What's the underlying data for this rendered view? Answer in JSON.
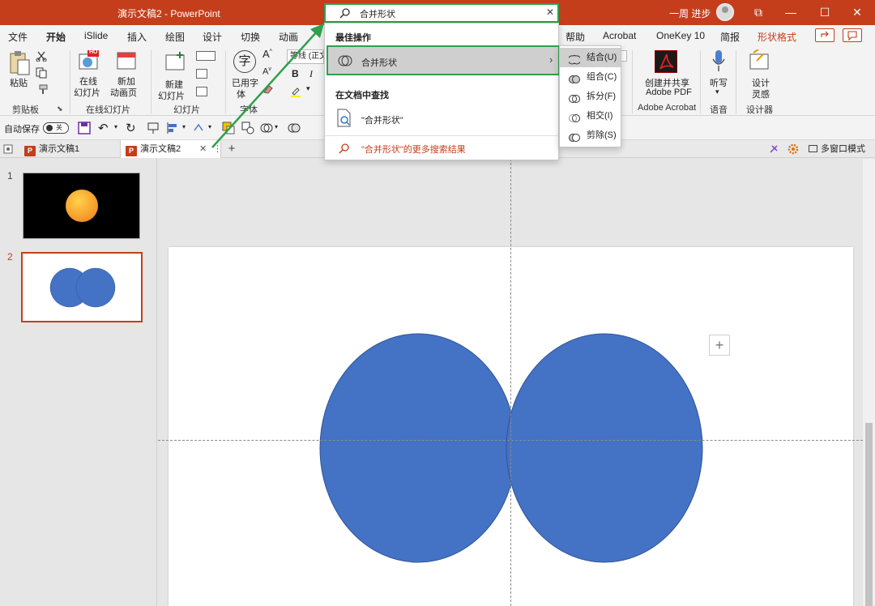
{
  "window": {
    "title": "演示文稿2 - PowerPoint",
    "user_name": "一周 进步",
    "controls": [
      "⧉",
      "—",
      "☐",
      "✕"
    ]
  },
  "search": {
    "value": "合并形状",
    "clear": "✕",
    "best_action_heading": "最佳操作",
    "best_action_label": "合并形状",
    "find_in_doc_heading": "在文档中查找",
    "find_in_doc_item": "\"合并形状\"",
    "more_results": "\"合并形状\"的更多搜索结果"
  },
  "merge_submenu": [
    {
      "label": "结合(U)",
      "selected": true
    },
    {
      "label": "组合(C)",
      "selected": false
    },
    {
      "label": "拆分(F)",
      "selected": false
    },
    {
      "label": "相交(I)",
      "selected": false
    },
    {
      "label": "剪除(S)",
      "selected": false
    }
  ],
  "ribbon_tabs": [
    "文件",
    "开始",
    "iSlide",
    "插入",
    "绘图",
    "设计",
    "切换",
    "动画",
    "帮助",
    "Acrobat",
    "OneKey 10",
    "简报",
    "形状格式"
  ],
  "active_tab": "开始",
  "ribbon": {
    "paste": "粘贴",
    "clipboard_group": "剪贴板",
    "online_slides": "在线\n幻灯片",
    "online_slides_l1": "在线",
    "online_slides_l2": "幻灯片",
    "new_anim_l1": "新加",
    "new_anim_l2": "动画页",
    "online_group": "在线幻灯片",
    "new_slide_l1": "新建",
    "new_slide_l2": "幻灯片",
    "slides_group": "幻灯片",
    "used_font_l1": "已用字",
    "used_font_l2": "体",
    "font_group": "字体",
    "font_name": "等线 (正文",
    "bold": "B",
    "italic": "I",
    "acrobat_btn_l1": "创建并共享",
    "acrobat_btn_l2": "Adobe PDF",
    "acrobat_group": "Adobe Acrobat",
    "dictate": "听写",
    "voice_group": "语音",
    "design_l1": "设计",
    "design_l2": "灵感",
    "designer_group": "设计器",
    "hot_badge": "HOT"
  },
  "qat": {
    "autosave": "自动保存",
    "toggle": "关"
  },
  "doc_tabs": [
    {
      "label": "演示文稿1",
      "active": false
    },
    {
      "label": "演示文稿2",
      "active": true
    }
  ],
  "doc_tab_add": "+",
  "multiwindow": "多窗口模式",
  "slides": [
    {
      "number": "1"
    },
    {
      "number": "2"
    }
  ],
  "colors": {
    "accent": "#c43e1c",
    "highlight": "#2ea14a",
    "shape_fill": "#4472c4",
    "shape_stroke": "#2f5597"
  }
}
